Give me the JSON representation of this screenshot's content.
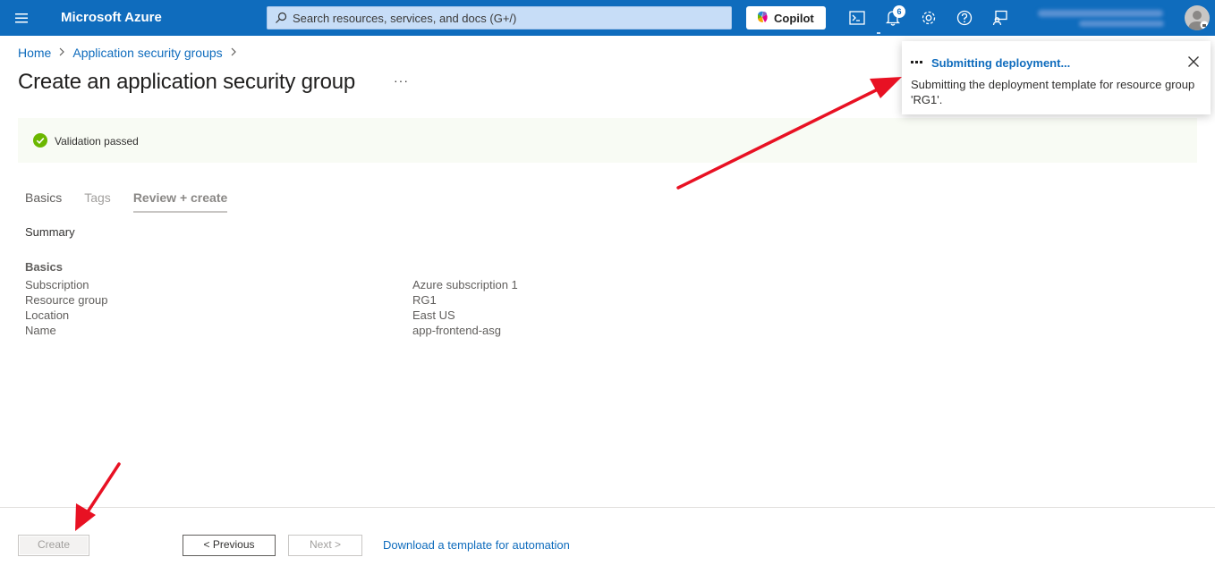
{
  "header": {
    "brand": "Microsoft Azure",
    "search_placeholder": "Search resources, services, and docs (G+/)",
    "copilot_label": "Copilot",
    "notification_count": "6",
    "colors": {
      "topbar": "#0f6cbd",
      "link": "#0f6cbd",
      "success": "#6bb700",
      "annotation_arrow": "#e81123"
    }
  },
  "breadcrumb": {
    "items": [
      "Home",
      "Application security groups"
    ]
  },
  "page": {
    "title": "Create an application security group",
    "more_label": "···"
  },
  "validation": {
    "text": "Validation passed"
  },
  "tabs": [
    {
      "label": "Basics",
      "state": "enabled"
    },
    {
      "label": "Tags",
      "state": "disabled"
    },
    {
      "label": "Review + create",
      "state": "selected"
    }
  ],
  "summary": {
    "heading": "Summary",
    "section": "Basics",
    "rows": [
      {
        "key": "Subscription",
        "value": "Azure subscription 1"
      },
      {
        "key": "Resource group",
        "value": "RG1"
      },
      {
        "key": "Location",
        "value": "East US"
      },
      {
        "key": "Name",
        "value": "app-frontend-asg"
      }
    ]
  },
  "footer": {
    "create_label": "Create",
    "previous_label": "< Previous",
    "next_label": "Next >",
    "download_link": "Download a template for automation"
  },
  "notification": {
    "title": "Submitting deployment...",
    "body": "Submitting the deployment template for resource group 'RG1'."
  }
}
